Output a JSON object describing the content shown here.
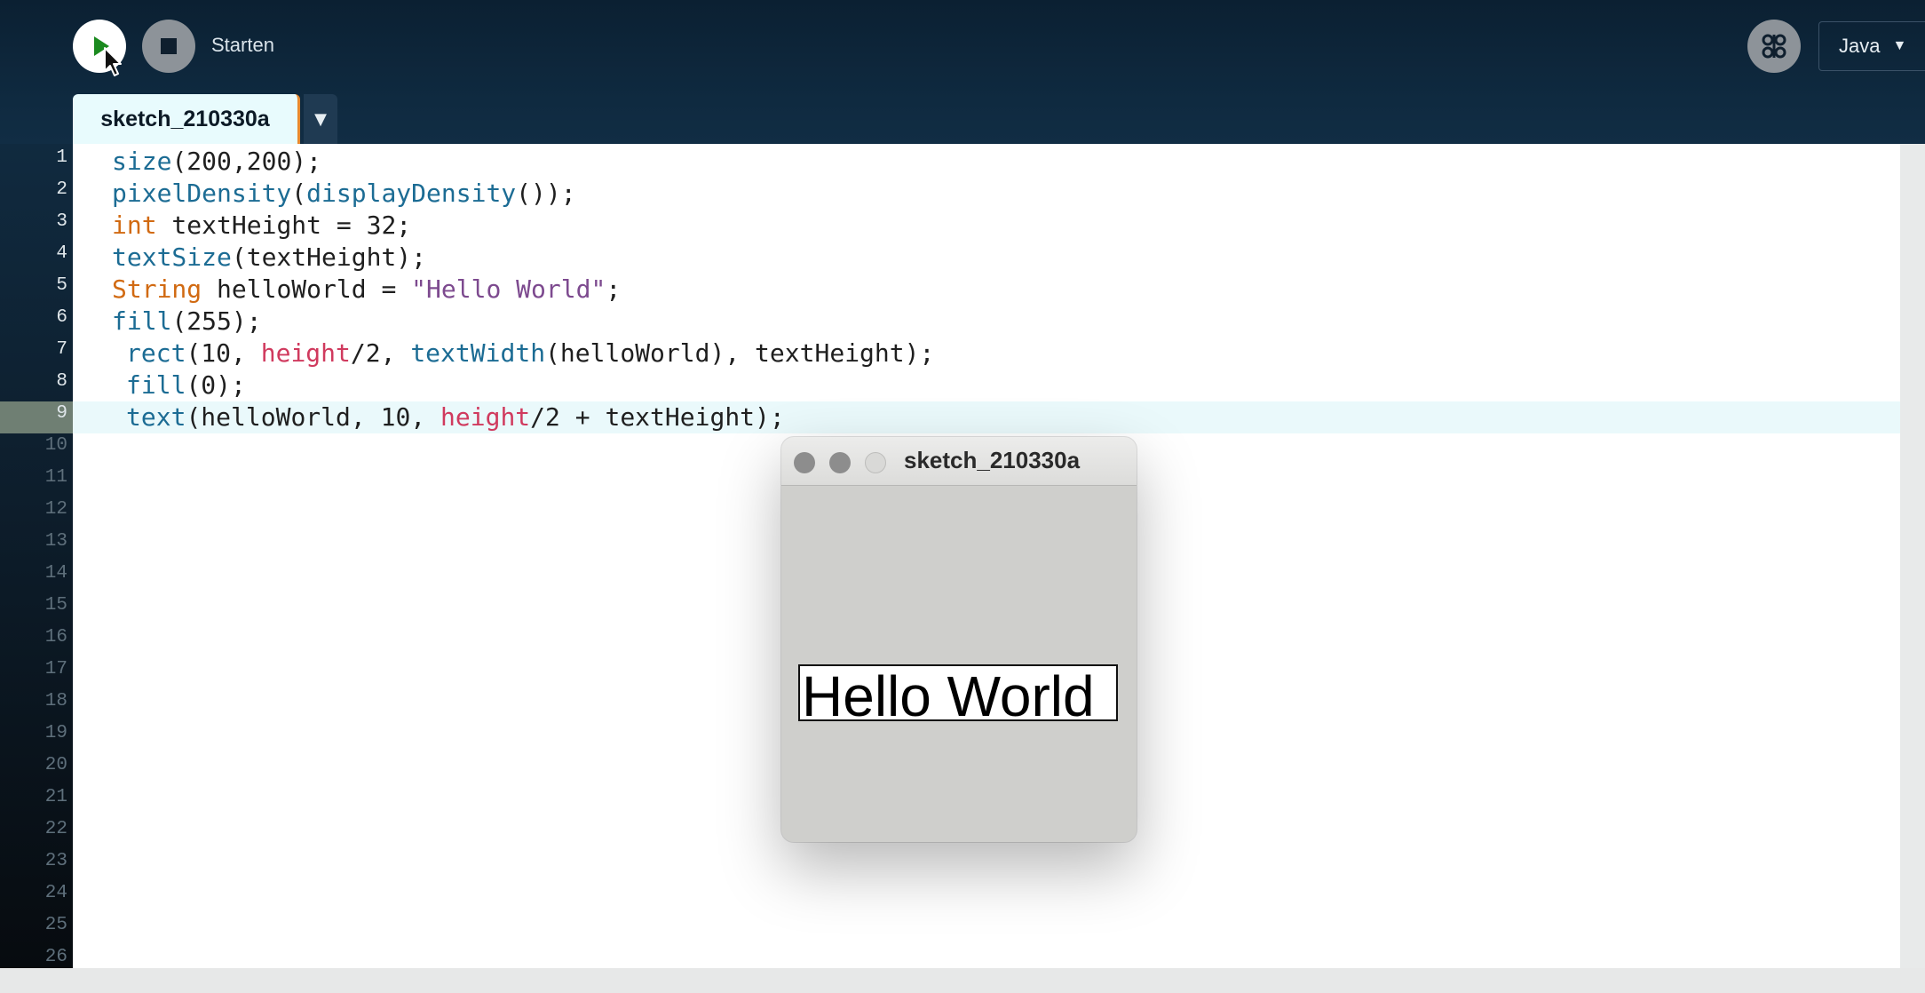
{
  "toolbar": {
    "run_label": "run",
    "stop_label": "stop",
    "status_text": "Starten",
    "mode": "Java",
    "mode_arrow": "▼"
  },
  "tab": {
    "name": "sketch_210330a",
    "arrow": "▼"
  },
  "editor": {
    "line_numbers": [
      "1",
      "2",
      "3",
      "4",
      "5",
      "6",
      "7",
      "8",
      "9",
      "10",
      "11",
      "12",
      "13",
      "14",
      "15",
      "16",
      "17",
      "18",
      "19",
      "20",
      "21",
      "22",
      "23",
      "24",
      "25",
      "26"
    ],
    "highlighted_line": "9",
    "code": {
      "l1_fn": "size",
      "l1_rest": "(200,200);",
      "l2_fn": "pixelDensity",
      "l2_open": "(",
      "l2_fn2": "displayDensity",
      "l2_rest": "());",
      "l3_kw": "int",
      "l3_rest": " textHeight = 32;",
      "l4_fn": "textSize",
      "l4_rest": "(textHeight);",
      "l5_kw": "String",
      "l5_mid": " helloWorld = ",
      "l5_str": "\"Hello World\"",
      "l5_end": ";",
      "l6_fn": "fill",
      "l6_rest": "(255);",
      "l7_fn": "rect",
      "l7_a": "(10, ",
      "l7_var": "height",
      "l7_b": "/2, ",
      "l7_fn2": "textWidth",
      "l7_c": "(helloWorld), textHeight);",
      "l8_fn": "fill",
      "l8_rest": "(0);",
      "l9_fn": "text",
      "l9_a": "(helloWorld, 10, ",
      "l9_var": "height",
      "l9_b": "/2 + textHeight);"
    }
  },
  "sketch_window": {
    "title": "sketch_210330a",
    "rendered_text": "Hello World"
  }
}
